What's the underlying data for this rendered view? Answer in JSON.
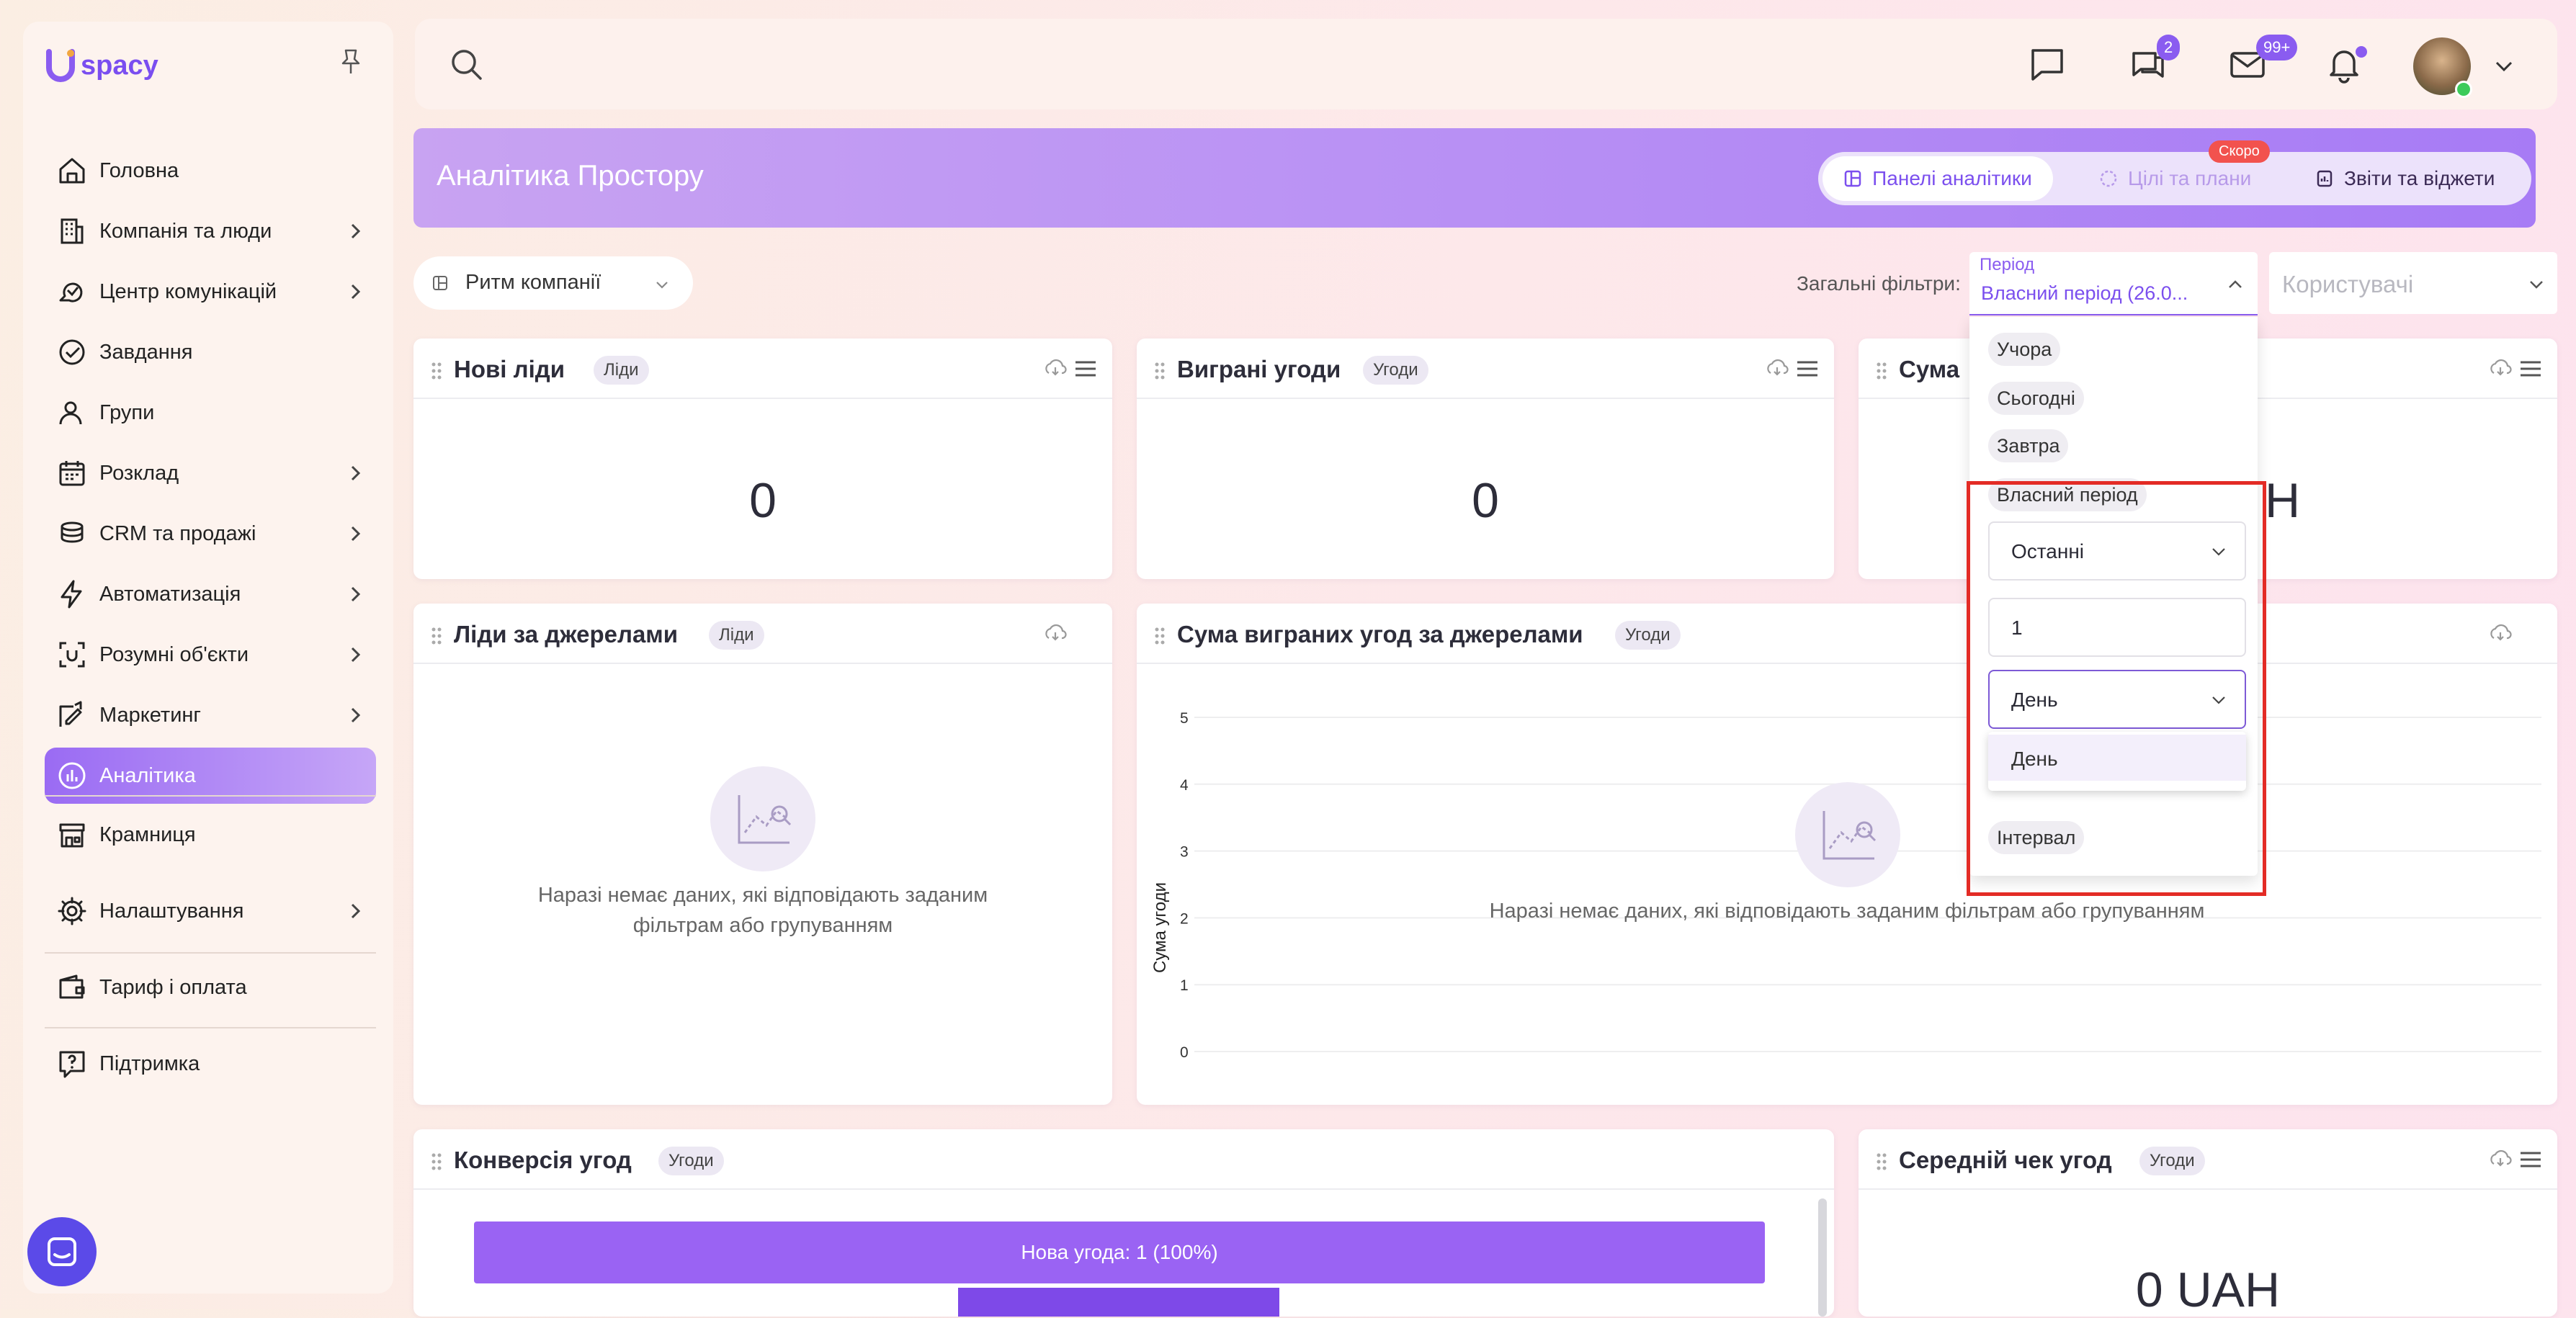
{
  "brand": {
    "name": "spacy",
    "accent": "#8a5cf0"
  },
  "sidebar": {
    "items": [
      {
        "label": "Головна",
        "icon": "home-icon",
        "chevron": false
      },
      {
        "label": "Компанія та люди",
        "icon": "building-icon",
        "chevron": true
      },
      {
        "label": "Центр комунікацій",
        "icon": "communication-icon",
        "chevron": true
      },
      {
        "label": "Завдання",
        "icon": "check-circle-icon",
        "chevron": false
      },
      {
        "label": "Групи",
        "icon": "users-icon",
        "chevron": false
      },
      {
        "label": "Розклад",
        "icon": "calendar-icon",
        "chevron": true
      },
      {
        "label": "CRM та продажі",
        "icon": "coins-icon",
        "chevron": true
      },
      {
        "label": "Автоматизація",
        "icon": "lightning-icon",
        "chevron": true
      },
      {
        "label": "Розумні об'єкти",
        "icon": "smart-object-icon",
        "chevron": true
      },
      {
        "label": "Маркетинг",
        "icon": "marketing-icon",
        "chevron": true
      },
      {
        "label": "Аналітика",
        "icon": "analytics-icon",
        "chevron": false,
        "active": true
      }
    ],
    "store": "Крамниця",
    "settings": "Налаштування",
    "tariff": "Тариф і оплата",
    "support": "Підтримка"
  },
  "topbar": {
    "chat_badge": "2",
    "mail_badge": "99+"
  },
  "banner": {
    "title": "Аналітика Простору",
    "tabs": [
      {
        "label": "Панелі аналітики",
        "active": true
      },
      {
        "label": "Цілі та плани",
        "disabled": true,
        "badge": "Скоро"
      },
      {
        "label": "Звіти та віджети"
      }
    ]
  },
  "filters": {
    "dashboard": "Ритм компанії",
    "label": "Загальні фільтри:",
    "period_label": "Період",
    "period_value": "Власний період (26.0...",
    "users_placeholder": "Користувачі"
  },
  "period_dropdown": {
    "quick": [
      "Учора",
      "Сьогодні",
      "Завтра"
    ],
    "custom_label": "Власний період",
    "mode": "Останні",
    "amount": "1",
    "unit": "День",
    "unit_options": [
      "День"
    ],
    "interval": "Інтервал"
  },
  "widgets": {
    "new_leads": {
      "title": "Нові ліди",
      "tag": "Ліди",
      "value": "0"
    },
    "won_deals": {
      "title": "Виграні угоди",
      "tag": "Угоди",
      "value": "0"
    },
    "sum": {
      "title": "Сума",
      "value_partial": "H"
    },
    "leads_by_source": {
      "title": "Ліди за джерелами",
      "tag": "Ліди",
      "empty_line1": "Наразі немає даних, які відповідають заданим",
      "empty_line2": "фільтрам або групуванням"
    },
    "won_sum_by_source": {
      "title": "Сума виграних угод за джерелами",
      "tag": "Угоди",
      "empty": "Наразі немає даних, які відповідають заданим фільтрам або групуванням"
    },
    "conversion": {
      "title": "Конверсія угод",
      "tag": "Угоди",
      "bar_label": "Нова угода: 1 (100%)"
    },
    "avg_check": {
      "title": "Середній чек угод",
      "tag": "Угоди",
      "value": "0 UAH"
    }
  },
  "chart_data": {
    "type": "bar",
    "ylabel": "Сума угоди",
    "ylim": [
      0,
      5
    ],
    "yticks": [
      "0",
      "1",
      "2",
      "3",
      "4",
      "5"
    ],
    "categories": [],
    "values": []
  }
}
